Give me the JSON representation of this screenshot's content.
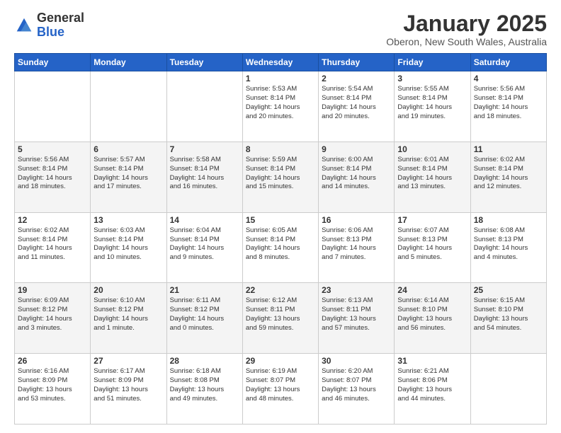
{
  "logo": {
    "general": "General",
    "blue": "Blue"
  },
  "header": {
    "month": "January 2025",
    "location": "Oberon, New South Wales, Australia"
  },
  "weekdays": [
    "Sunday",
    "Monday",
    "Tuesday",
    "Wednesday",
    "Thursday",
    "Friday",
    "Saturday"
  ],
  "weeks": [
    [
      {
        "day": "",
        "info": ""
      },
      {
        "day": "",
        "info": ""
      },
      {
        "day": "",
        "info": ""
      },
      {
        "day": "1",
        "info": "Sunrise: 5:53 AM\nSunset: 8:14 PM\nDaylight: 14 hours\nand 20 minutes."
      },
      {
        "day": "2",
        "info": "Sunrise: 5:54 AM\nSunset: 8:14 PM\nDaylight: 14 hours\nand 20 minutes."
      },
      {
        "day": "3",
        "info": "Sunrise: 5:55 AM\nSunset: 8:14 PM\nDaylight: 14 hours\nand 19 minutes."
      },
      {
        "day": "4",
        "info": "Sunrise: 5:56 AM\nSunset: 8:14 PM\nDaylight: 14 hours\nand 18 minutes."
      }
    ],
    [
      {
        "day": "5",
        "info": "Sunrise: 5:56 AM\nSunset: 8:14 PM\nDaylight: 14 hours\nand 18 minutes."
      },
      {
        "day": "6",
        "info": "Sunrise: 5:57 AM\nSunset: 8:14 PM\nDaylight: 14 hours\nand 17 minutes."
      },
      {
        "day": "7",
        "info": "Sunrise: 5:58 AM\nSunset: 8:14 PM\nDaylight: 14 hours\nand 16 minutes."
      },
      {
        "day": "8",
        "info": "Sunrise: 5:59 AM\nSunset: 8:14 PM\nDaylight: 14 hours\nand 15 minutes."
      },
      {
        "day": "9",
        "info": "Sunrise: 6:00 AM\nSunset: 8:14 PM\nDaylight: 14 hours\nand 14 minutes."
      },
      {
        "day": "10",
        "info": "Sunrise: 6:01 AM\nSunset: 8:14 PM\nDaylight: 14 hours\nand 13 minutes."
      },
      {
        "day": "11",
        "info": "Sunrise: 6:02 AM\nSunset: 8:14 PM\nDaylight: 14 hours\nand 12 minutes."
      }
    ],
    [
      {
        "day": "12",
        "info": "Sunrise: 6:02 AM\nSunset: 8:14 PM\nDaylight: 14 hours\nand 11 minutes."
      },
      {
        "day": "13",
        "info": "Sunrise: 6:03 AM\nSunset: 8:14 PM\nDaylight: 14 hours\nand 10 minutes."
      },
      {
        "day": "14",
        "info": "Sunrise: 6:04 AM\nSunset: 8:14 PM\nDaylight: 14 hours\nand 9 minutes."
      },
      {
        "day": "15",
        "info": "Sunrise: 6:05 AM\nSunset: 8:14 PM\nDaylight: 14 hours\nand 8 minutes."
      },
      {
        "day": "16",
        "info": "Sunrise: 6:06 AM\nSunset: 8:13 PM\nDaylight: 14 hours\nand 7 minutes."
      },
      {
        "day": "17",
        "info": "Sunrise: 6:07 AM\nSunset: 8:13 PM\nDaylight: 14 hours\nand 5 minutes."
      },
      {
        "day": "18",
        "info": "Sunrise: 6:08 AM\nSunset: 8:13 PM\nDaylight: 14 hours\nand 4 minutes."
      }
    ],
    [
      {
        "day": "19",
        "info": "Sunrise: 6:09 AM\nSunset: 8:12 PM\nDaylight: 14 hours\nand 3 minutes."
      },
      {
        "day": "20",
        "info": "Sunrise: 6:10 AM\nSunset: 8:12 PM\nDaylight: 14 hours\nand 1 minute."
      },
      {
        "day": "21",
        "info": "Sunrise: 6:11 AM\nSunset: 8:12 PM\nDaylight: 14 hours\nand 0 minutes."
      },
      {
        "day": "22",
        "info": "Sunrise: 6:12 AM\nSunset: 8:11 PM\nDaylight: 13 hours\nand 59 minutes."
      },
      {
        "day": "23",
        "info": "Sunrise: 6:13 AM\nSunset: 8:11 PM\nDaylight: 13 hours\nand 57 minutes."
      },
      {
        "day": "24",
        "info": "Sunrise: 6:14 AM\nSunset: 8:10 PM\nDaylight: 13 hours\nand 56 minutes."
      },
      {
        "day": "25",
        "info": "Sunrise: 6:15 AM\nSunset: 8:10 PM\nDaylight: 13 hours\nand 54 minutes."
      }
    ],
    [
      {
        "day": "26",
        "info": "Sunrise: 6:16 AM\nSunset: 8:09 PM\nDaylight: 13 hours\nand 53 minutes."
      },
      {
        "day": "27",
        "info": "Sunrise: 6:17 AM\nSunset: 8:09 PM\nDaylight: 13 hours\nand 51 minutes."
      },
      {
        "day": "28",
        "info": "Sunrise: 6:18 AM\nSunset: 8:08 PM\nDaylight: 13 hours\nand 49 minutes."
      },
      {
        "day": "29",
        "info": "Sunrise: 6:19 AM\nSunset: 8:07 PM\nDaylight: 13 hours\nand 48 minutes."
      },
      {
        "day": "30",
        "info": "Sunrise: 6:20 AM\nSunset: 8:07 PM\nDaylight: 13 hours\nand 46 minutes."
      },
      {
        "day": "31",
        "info": "Sunrise: 6:21 AM\nSunset: 8:06 PM\nDaylight: 13 hours\nand 44 minutes."
      },
      {
        "day": "",
        "info": ""
      }
    ]
  ]
}
